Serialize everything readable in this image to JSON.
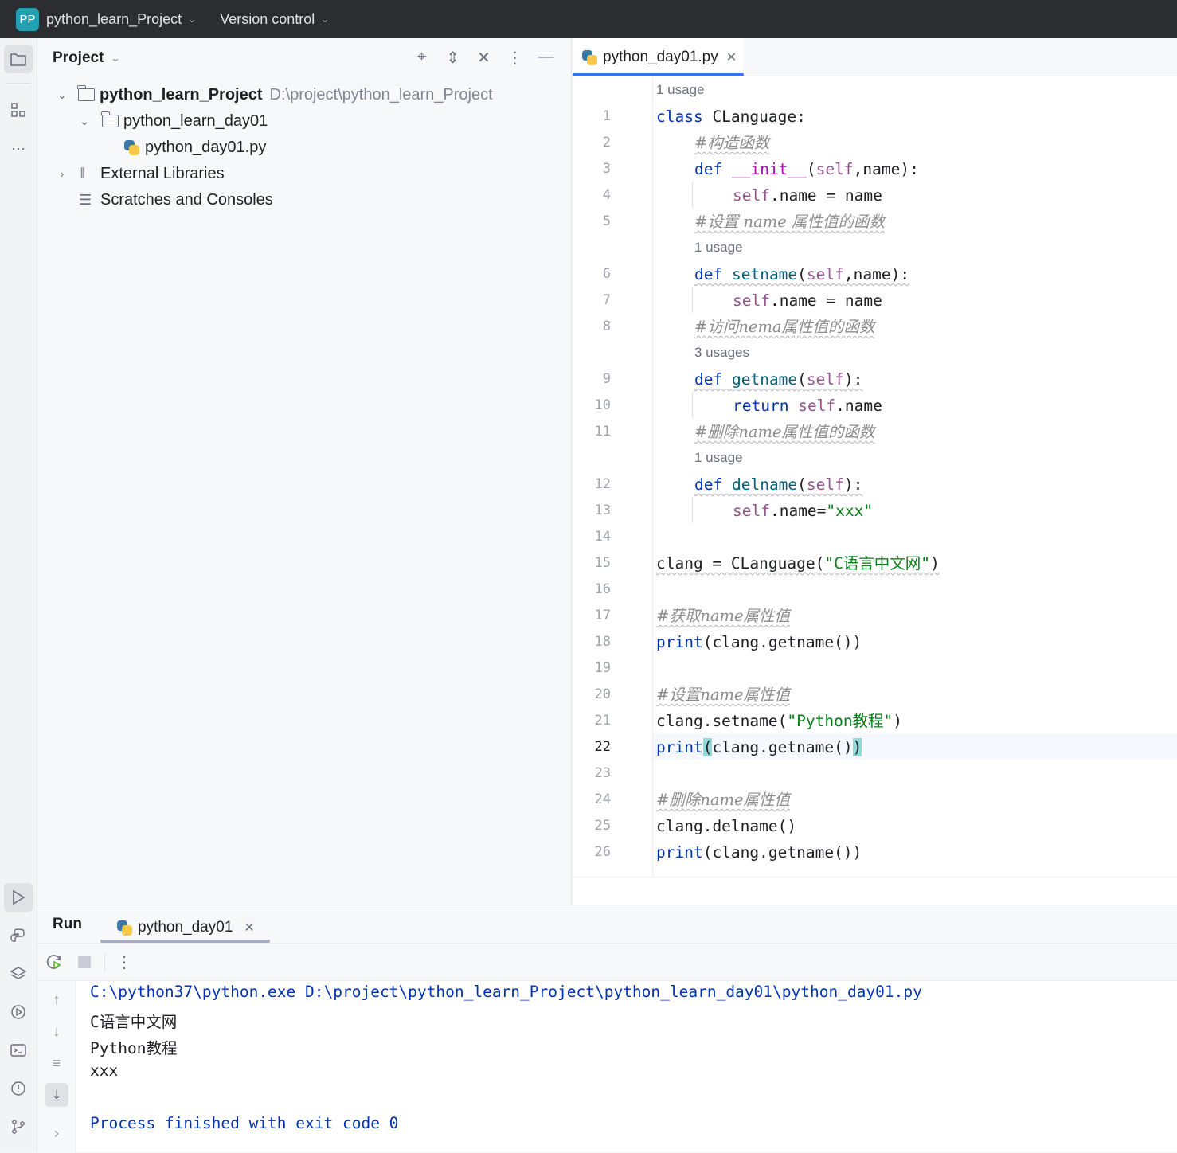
{
  "titlebar": {
    "logo": "PP",
    "project_name": "python_learn_Project",
    "vcs_label": "Version control"
  },
  "left_stripe": {
    "items": [
      "folder-icon",
      "structure-icon",
      "more-icon"
    ],
    "bottom_items": [
      "run-icon",
      "python-console-icon",
      "layers-icon",
      "services-icon",
      "terminal-icon",
      "problems-icon",
      "git-icon"
    ]
  },
  "project_panel": {
    "title": "Project",
    "tree": {
      "root_name": "python_learn_Project",
      "root_path": "D:\\project\\python_learn_Project",
      "folder": "python_learn_day01",
      "file": "python_day01.py",
      "external_libraries": "External Libraries",
      "scratches": "Scratches and Consoles"
    }
  },
  "editor": {
    "tab_label": "python_day01.py",
    "current_line": 22,
    "hints": {
      "h0": "1 usage",
      "h5": "1 usage",
      "h8": "3 usages",
      "h11": "1 usage"
    },
    "lines": {
      "l1_kw": "class",
      "l1_rest": " CLanguage:",
      "l2_cm": "#构造函数",
      "l3_kw": "def",
      "l3_fn": "__init__",
      "l3_a": "(",
      "l3_self": "self",
      "l3_b": ",name):",
      "l4_self": "self",
      "l4_rest": ".name = name",
      "l5_cm": "#设置 name 属性值的函数",
      "l6_kw": "def",
      "l6_fn": "setname",
      "l6_a": "(",
      "l6_self": "self",
      "l6_b": ",name):",
      "l7_self": "self",
      "l7_rest": ".name = name",
      "l8_cm": "#访问nema属性值的函数",
      "l9_kw": "def",
      "l9_fn": "getname",
      "l9_a": "(",
      "l9_self": "self",
      "l9_b": "):",
      "l10_kw": "return",
      "l10_self": "self",
      "l10_rest": ".name",
      "l11_cm": "#删除name属性值的函数",
      "l12_kw": "def",
      "l12_fn": "delname",
      "l12_a": "(",
      "l12_self": "self",
      "l12_b": "):",
      "l13_self": "self",
      "l13_rest": ".name=",
      "l13_str": "\"xxx\"",
      "l15_a": "clang = CLanguage(",
      "l15_str": "\"C语言中文网\"",
      "l15_b": ")",
      "l17_cm": "#获取name属性值",
      "l18_kw": "print",
      "l18_rest": "(clang.getname())",
      "l20_cm": "#设置name属性值",
      "l21_a": "clang.setname(",
      "l21_str": "\"Python教程\"",
      "l21_b": ")",
      "l22_kw": "print",
      "l22_a": "(",
      "l22_mid": "clang.getname()",
      "l22_b": ")",
      "l24_cm": "#删除name属性值",
      "l25_rest": "clang.delname()",
      "l26_kw": "print",
      "l26_rest": "(clang.getname())"
    }
  },
  "run_panel": {
    "label": "Run",
    "tab_label": "python_day01",
    "output": {
      "command": "C:\\python37\\python.exe D:\\project\\python_learn_Project\\python_learn_day01\\python_day01.py",
      "line1": "C语言中文网",
      "line2": "Python教程",
      "line3": "xxx",
      "exit": "Process finished with exit code 0"
    }
  },
  "colors": {
    "keyword": "#0033b3",
    "self": "#94558d",
    "function": "#00627a",
    "string": "#067d17",
    "comment": "#8c8c8c",
    "accent": "#3574f0",
    "logo_bg": "#21a0b4"
  }
}
